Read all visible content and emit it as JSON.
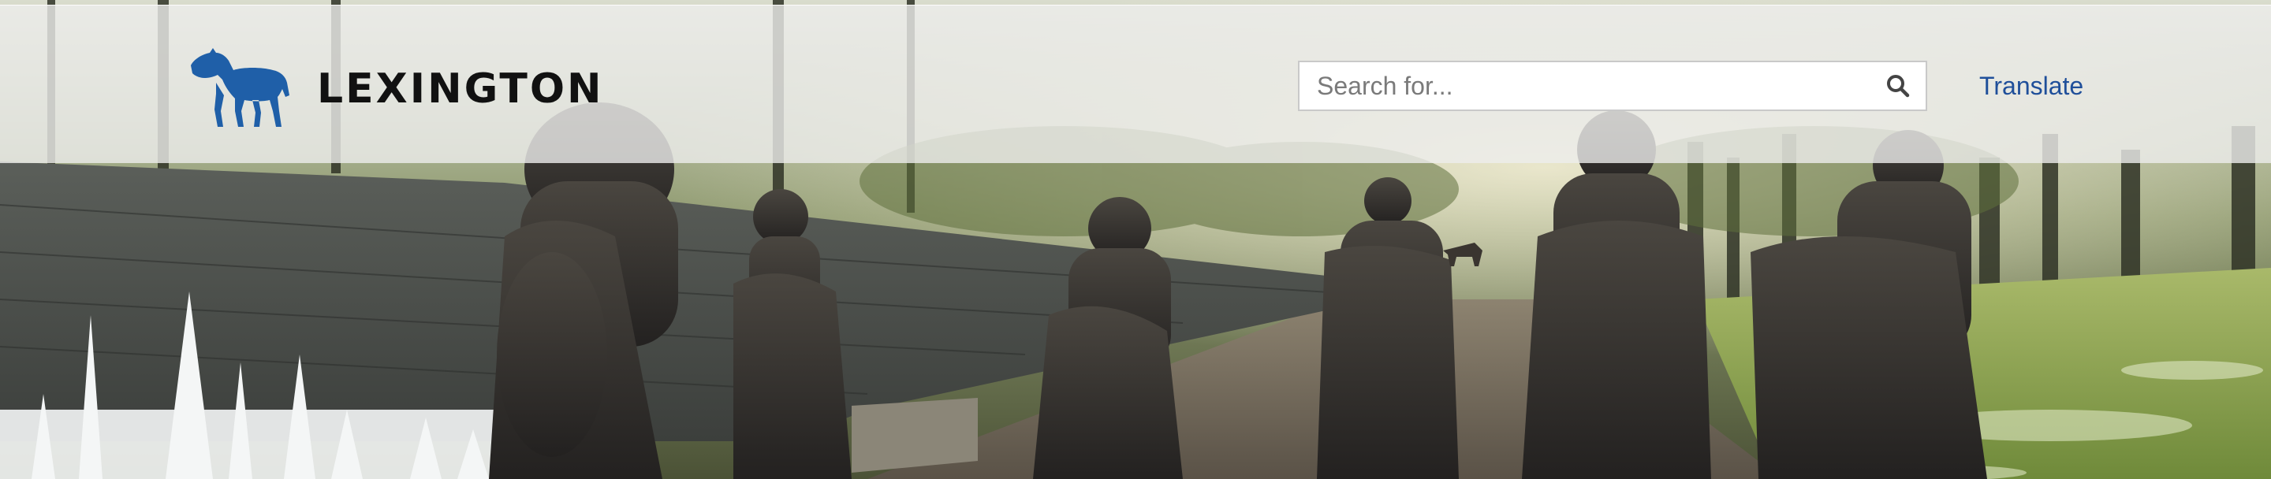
{
  "header": {
    "logo_text": "LEXINGTON",
    "logo_icon": "horse-icon",
    "brand_color": "#1f5fa8"
  },
  "search": {
    "placeholder": "Search for...",
    "value": "",
    "icon": "search-icon"
  },
  "nav": {
    "translate_label": "Translate",
    "link_color": "#1f4f9a"
  },
  "hero": {
    "image_alt": "Bronze statues of racehorses and jockeys beside a stone wall and fountain"
  }
}
